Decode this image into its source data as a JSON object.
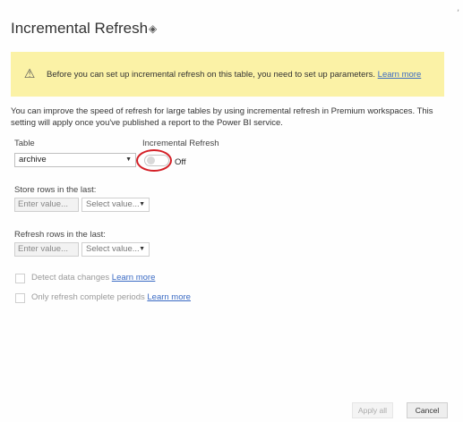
{
  "dialog": {
    "title": "Incremental Refresh",
    "title_icon": "diamond-icon"
  },
  "banner": {
    "icon": "warning-icon",
    "text": "Before you can set up incremental refresh on this table, you need to set up parameters.",
    "link": "Learn more"
  },
  "description": "You can improve the speed of refresh for large tables by using incremental refresh in Premium workspaces. This setting will apply once you've published a report to the Power BI service.",
  "table": {
    "label": "Table",
    "value": "archive"
  },
  "incremental_refresh": {
    "label": "Incremental Refresh",
    "state": "Off"
  },
  "store_rows": {
    "label": "Store rows in the last:",
    "input_placeholder": "Enter value...",
    "select_placeholder": "Select value..."
  },
  "refresh_rows": {
    "label": "Refresh rows in the last:",
    "input_placeholder": "Enter value...",
    "select_placeholder": "Select value..."
  },
  "options": [
    {
      "label": "Detect data changes",
      "link": "Learn more"
    },
    {
      "label": "Only refresh complete periods",
      "link": "Learn more"
    }
  ],
  "buttons": {
    "apply": "Apply all",
    "cancel": "Cancel"
  },
  "colors": {
    "banner_bg": "#fbf2a6",
    "link": "#3b6bc4",
    "highlight_circle": "#d41f26"
  }
}
